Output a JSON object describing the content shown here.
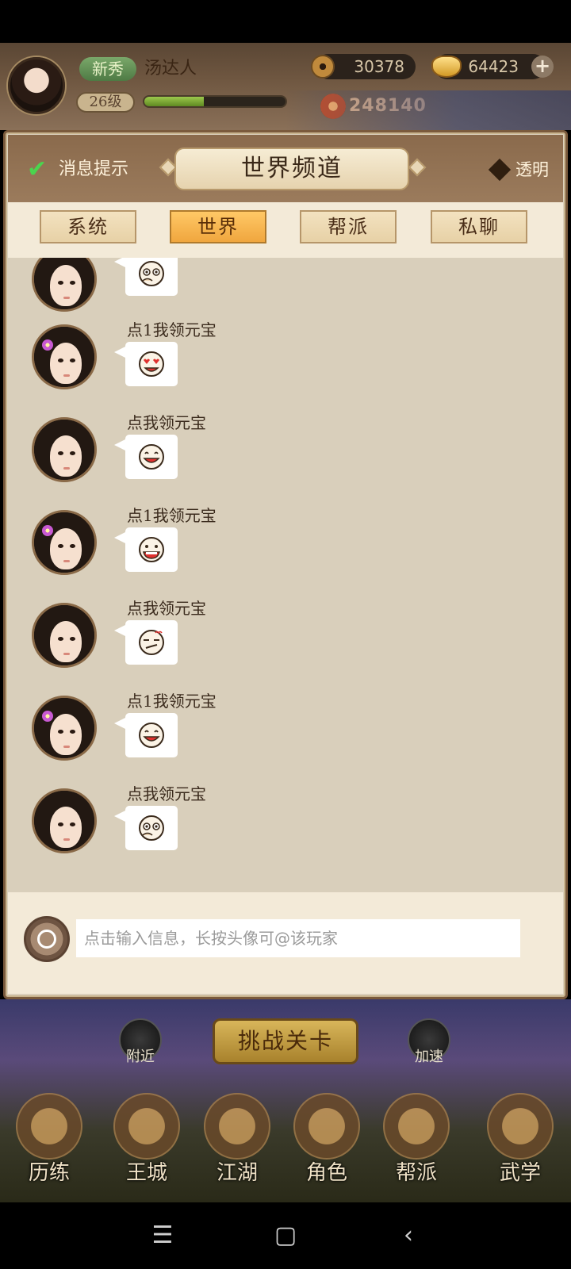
{
  "hud": {
    "rank_badge": "新秀",
    "player_name": "汤达人",
    "level": "26级",
    "exp_fraction": 0.42,
    "copper": "30378",
    "gold": "64423",
    "power": "248140"
  },
  "chat": {
    "notify_label": "消息提示",
    "notify_checked": true,
    "title": "世界频道",
    "transparent_label": "透明",
    "tabs": [
      {
        "label": "系统",
        "active": false
      },
      {
        "label": "世界",
        "active": true
      },
      {
        "label": "帮派",
        "active": false
      },
      {
        "label": "私聊",
        "active": false
      }
    ],
    "messages": [
      {
        "text": "",
        "avatar": "girl-plain",
        "emoji": "hand-on-face-emoji"
      },
      {
        "text": "点1我领元宝",
        "avatar": "girl-flower",
        "emoji": "heart-eyes-emoji"
      },
      {
        "text": "点我领元宝",
        "avatar": "girl-plain",
        "emoji": "laughing-emoji"
      },
      {
        "text": "点1我领元宝",
        "avatar": "girl-flower",
        "emoji": "tongue-out-emoji"
      },
      {
        "text": "点我领元宝",
        "avatar": "girl-plain",
        "emoji": "smirk-emoji"
      },
      {
        "text": "点1我领元宝",
        "avatar": "girl-flower",
        "emoji": "laughing-emoji"
      },
      {
        "text": "点我领元宝",
        "avatar": "girl-plain",
        "emoji": "hand-on-face-emoji"
      }
    ],
    "input_placeholder": "点击输入信息，长按头像可@该玩家"
  },
  "game": {
    "nearby_label": "附近",
    "speedup_label": "加速",
    "challenge_label": "挑战关卡",
    "nav": [
      "历练",
      "王城",
      "江湖",
      "角色",
      "帮派",
      "武学"
    ]
  },
  "system_nav": {
    "menu_icon": "menu-icon",
    "home_icon": "home-icon",
    "back_icon": "back-icon"
  }
}
